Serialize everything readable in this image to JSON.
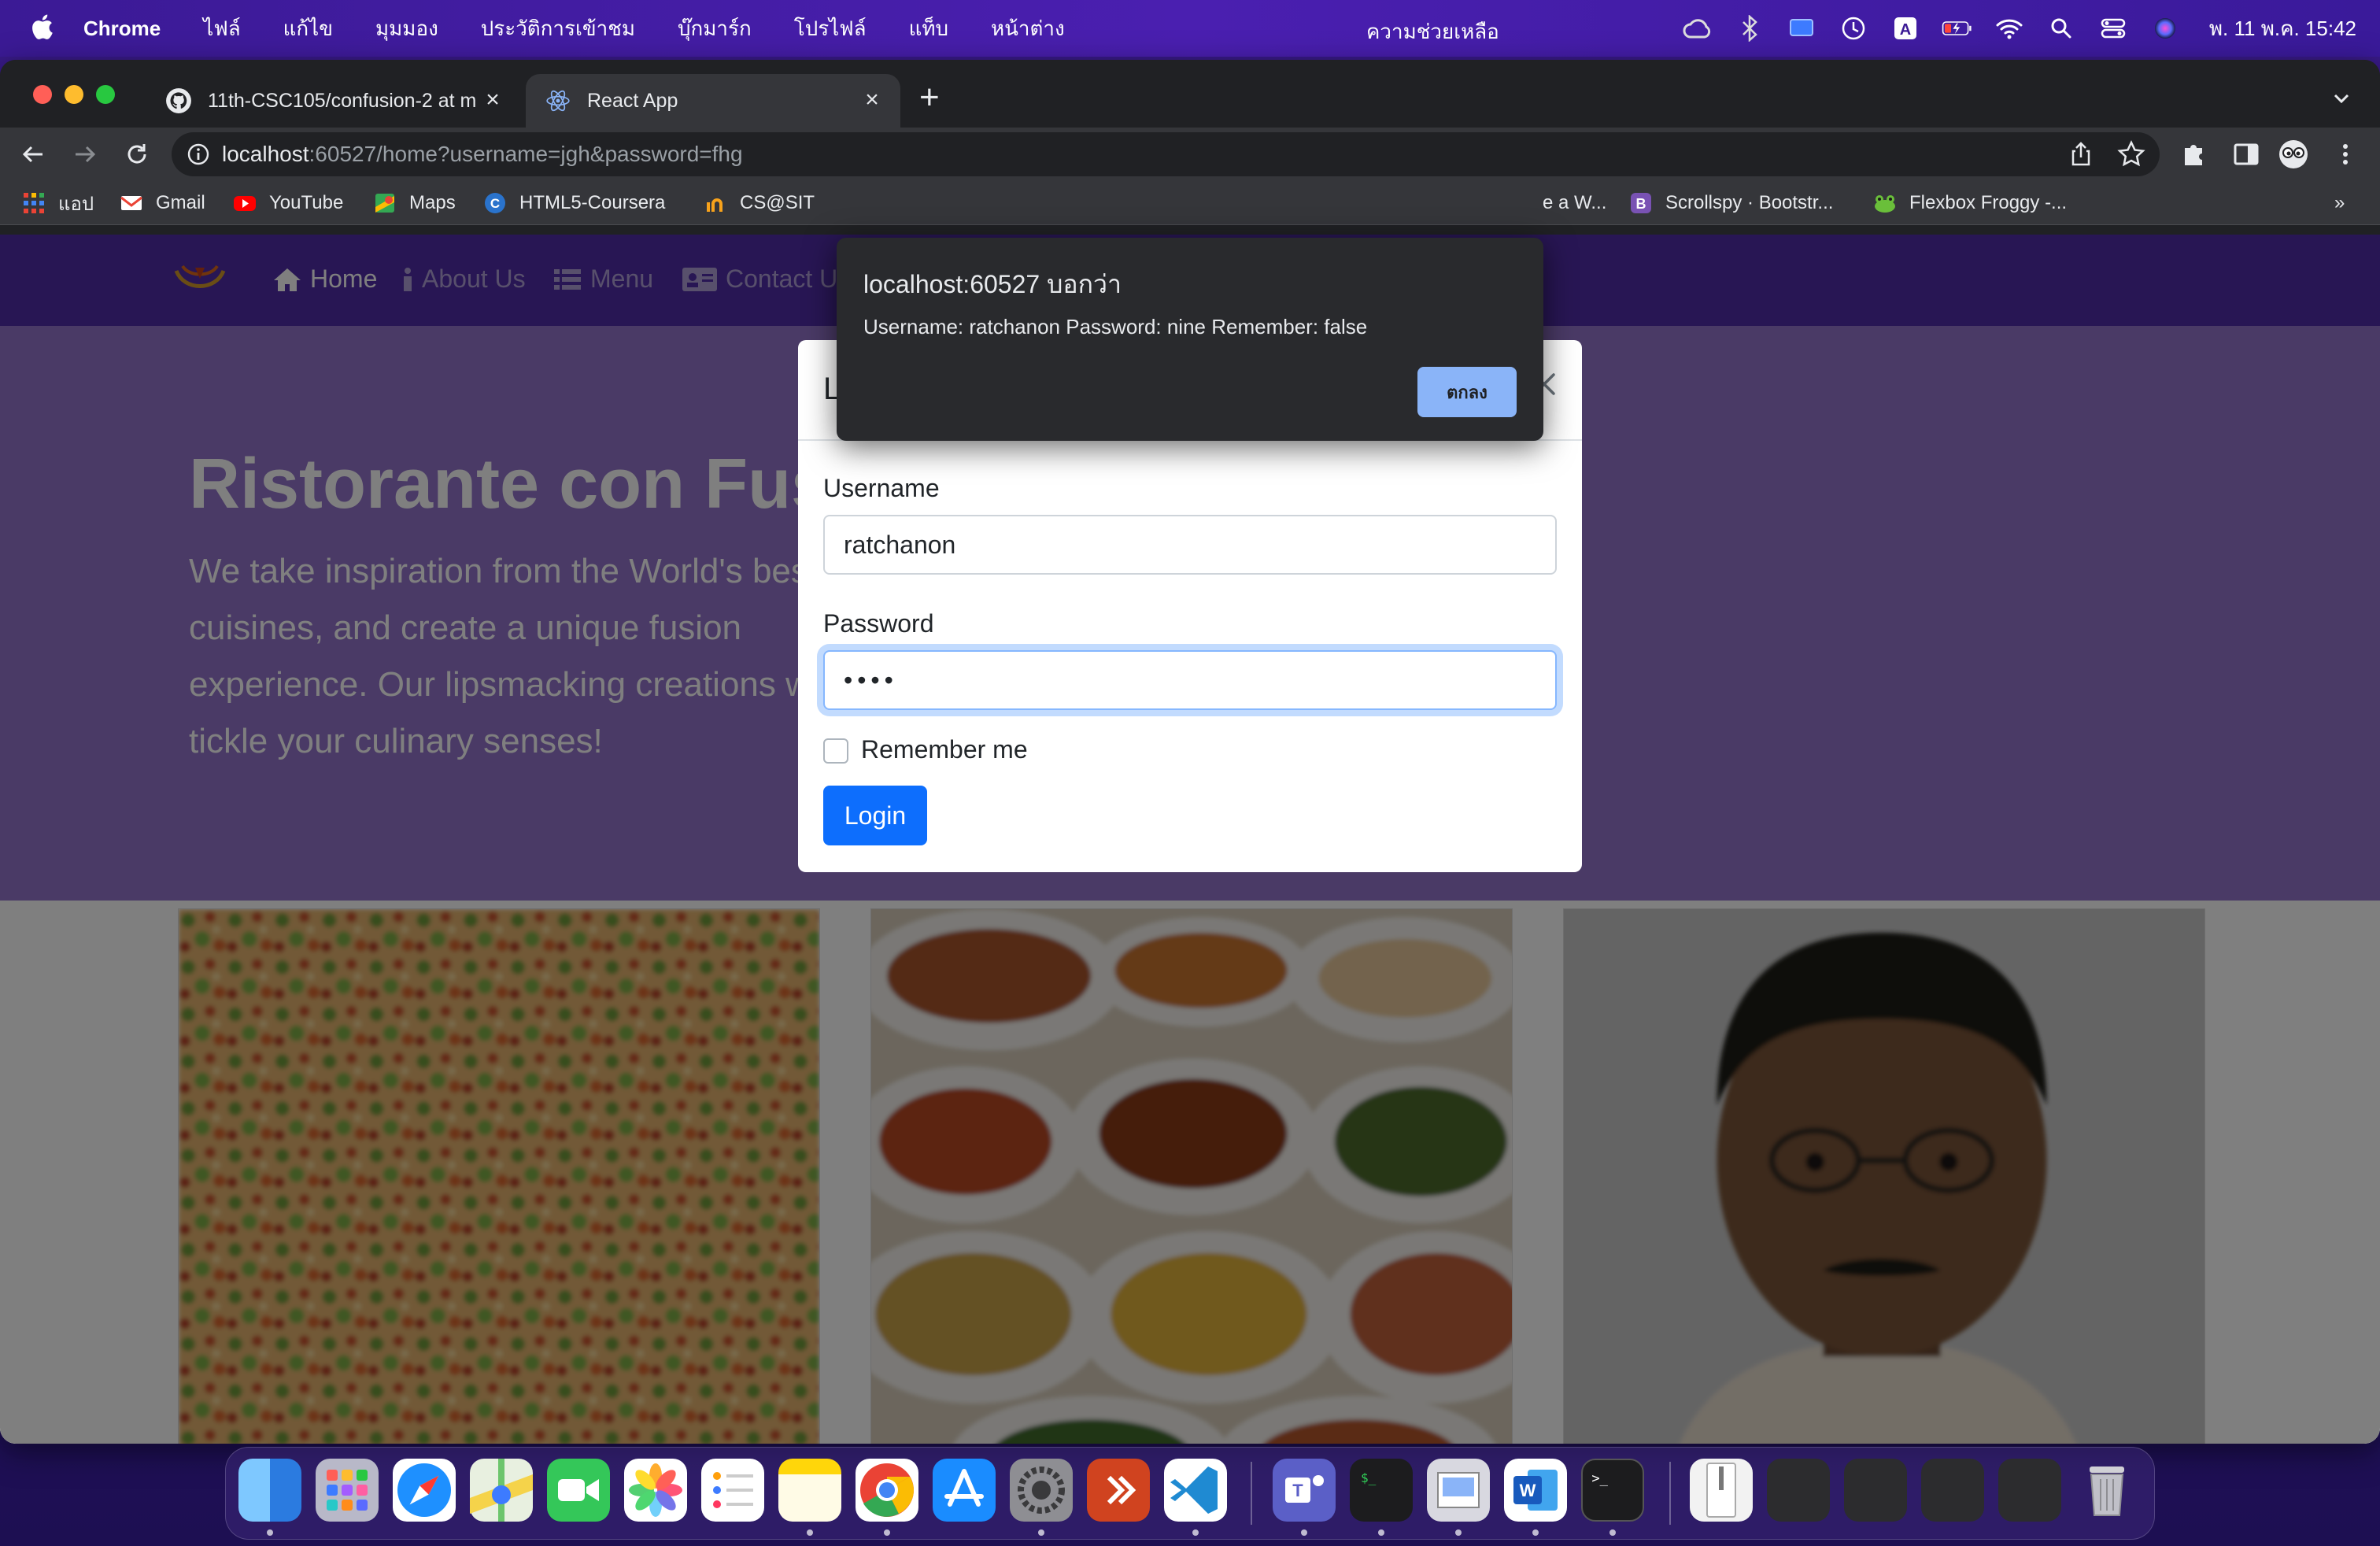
{
  "menubar": {
    "app_name": "Chrome",
    "menus": [
      "ไฟล์",
      "แก้ไข",
      "มุมมอง",
      "ประวัติการเข้าชม",
      "บุ๊กมาร์ก",
      "โปรไฟล์",
      "แท็บ",
      "หน้าต่าง"
    ],
    "help": "ความช่วยเหลือ",
    "clock": "พ. 11 พ.ค.  15:42"
  },
  "browser": {
    "tabs": [
      {
        "title": "11th-CSC105/confusion-2 at m",
        "icon": "github-icon"
      },
      {
        "title": "React App",
        "icon": "react-icon"
      }
    ],
    "url_host": "localhost",
    "url_rest": ":60527/home?username=jgh&password=fhg",
    "bookmarks": [
      {
        "label": "แอป",
        "icon": "apps-grid-icon"
      },
      {
        "label": "Gmail",
        "icon": "gmail-icon"
      },
      {
        "label": "YouTube",
        "icon": "youtube-icon"
      },
      {
        "label": "Maps",
        "icon": "maps-icon"
      },
      {
        "label": "HTML5-Coursera",
        "icon": "coursera-icon"
      },
      {
        "label": "CS@SIT",
        "icon": "sit-icon"
      },
      {
        "label": "e a W...",
        "icon": ""
      },
      {
        "label": "Scrollspy · Bootstr...",
        "icon": "bootstrap-icon"
      },
      {
        "label": "Flexbox Froggy -...",
        "icon": "frog-icon"
      }
    ],
    "overflow": "»"
  },
  "page": {
    "nav": [
      "Home",
      "About Us",
      "Menu",
      "Contact Us"
    ],
    "heading": "Ristorante con Fusion",
    "lead": "We take inspiration from the World's best cuisines, and create a unique fusion experience. Our lipsmacking creations will tickle your culinary senses!"
  },
  "modal": {
    "title": "Login",
    "username_label": "Username",
    "username_value": "ratchanon",
    "password_label": "Password",
    "password_value": "nine",
    "remember_label": "Remember me",
    "login_button": "Login"
  },
  "alert": {
    "title": "localhost:60527 บอกว่า",
    "message": "Username: ratchanon Password: nine Remember: false",
    "ok": "ตกลง"
  },
  "colors": {
    "navbar": "#512da8",
    "jumbotron": "#9575cd",
    "primary_button": "#0d6efd",
    "alert_button": "#8ab4f8"
  }
}
